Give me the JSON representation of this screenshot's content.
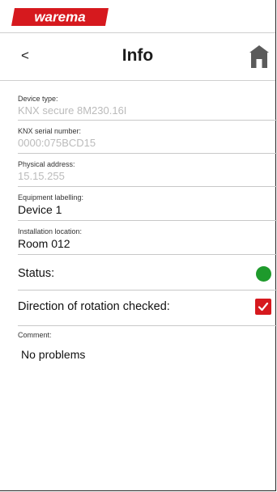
{
  "brand": {
    "logo_text": "warema",
    "logo_color": "#d6191e"
  },
  "header": {
    "back_label": "<",
    "title": "Info"
  },
  "fields": [
    {
      "label": "Device type:",
      "value": "KNX secure 8M230.16I"
    },
    {
      "label": "KNX serial number:",
      "value": "0000:075BCD15"
    },
    {
      "label": "Physical address:",
      "value": "15.15.255"
    },
    {
      "label": "Equipment labelling:",
      "value": "Device 1"
    },
    {
      "label": "Installation location:",
      "value": "Room 012"
    }
  ],
  "status": {
    "label": "Status:",
    "color": "#1e9a2c"
  },
  "rotation": {
    "label": "Direction of rotation checked:",
    "checked": true
  },
  "comment": {
    "label": "Comment:",
    "value": "No problems"
  }
}
